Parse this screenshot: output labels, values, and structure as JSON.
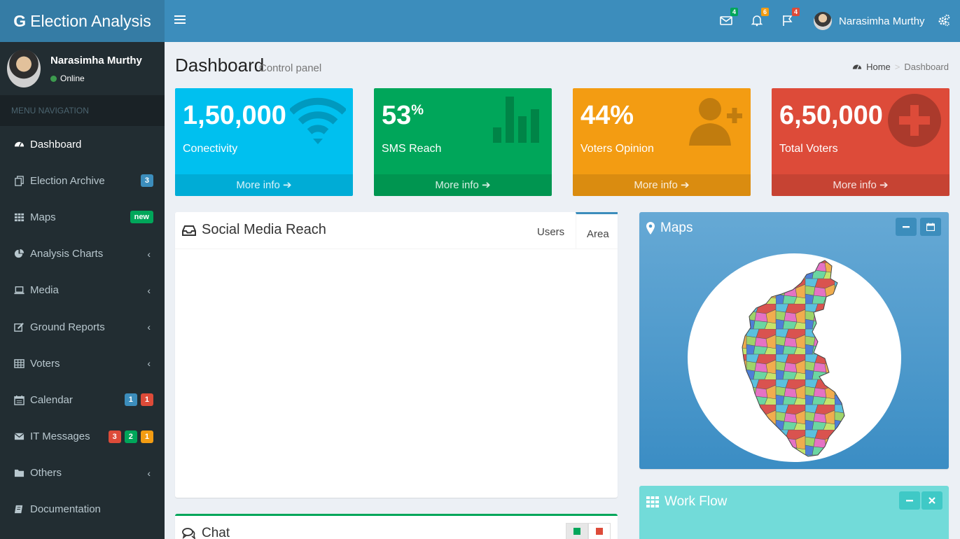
{
  "brand": {
    "logo_letter": "G",
    "name": "Election Analysis"
  },
  "topbar": {
    "notifications": [
      {
        "name": "mail",
        "count": "4",
        "color": "#00a65a"
      },
      {
        "name": "bell",
        "count": "6",
        "color": "#f39c12"
      },
      {
        "name": "flag",
        "count": "4",
        "color": "#dd4b39"
      }
    ],
    "user_name": "Narasimha Murthy"
  },
  "sidebar": {
    "user_name": "Narasimha Murthy",
    "status": "Online",
    "menu_header": "MENU NAVIGATION",
    "items": [
      {
        "label": "Dashboard",
        "icon": "dashboard-icon"
      },
      {
        "label": "Election Archive",
        "icon": "archive-icon",
        "badges": [
          {
            "text": "3",
            "color": "#3c8dbc"
          }
        ]
      },
      {
        "label": "Maps",
        "icon": "grid-icon",
        "badges": [
          {
            "text": "new",
            "color": "#00a65a"
          }
        ]
      },
      {
        "label": "Analysis Charts",
        "icon": "pie-chart-icon",
        "chevron": "‹"
      },
      {
        "label": "Media",
        "icon": "laptop-icon",
        "chevron": "‹"
      },
      {
        "label": "Ground Reports",
        "icon": "edit-icon",
        "chevron": "‹"
      },
      {
        "label": "Voters",
        "icon": "table-icon",
        "chevron": "‹"
      },
      {
        "label": "Calendar",
        "icon": "calendar-icon",
        "badges": [
          {
            "text": "1",
            "color": "#3c8dbc"
          },
          {
            "text": "1",
            "color": "#dd4b39"
          }
        ]
      },
      {
        "label": "IT Messages",
        "icon": "envelope-icon",
        "badges": [
          {
            "text": "3",
            "color": "#dd4b39"
          },
          {
            "text": "2",
            "color": "#00a65a"
          },
          {
            "text": "1",
            "color": "#f39c12"
          }
        ]
      },
      {
        "label": "Others",
        "icon": "folder-icon",
        "chevron": "‹"
      },
      {
        "label": "Documentation",
        "icon": "book-icon"
      }
    ]
  },
  "header": {
    "title": "Dashboard",
    "subtitle": "Control panel",
    "breadcrumb_home": "Home",
    "breadcrumb_sep": ">",
    "breadcrumb_current": "Dashboard"
  },
  "stats": [
    {
      "value": "1,50,000",
      "suffix": "",
      "label": "Conectivity",
      "more": "More info",
      "color": "#00c0ef",
      "icon": "wifi-icon"
    },
    {
      "value": "53",
      "suffix": "%",
      "label": "SMS Reach",
      "more": "More info",
      "color": "#00a65a",
      "icon": "bar-chart-icon"
    },
    {
      "value": "44%",
      "suffix": "",
      "label": "Voters Opinion",
      "more": "More info",
      "color": "#f39c12",
      "icon": "user-plus-icon"
    },
    {
      "value": "6,50,000",
      "suffix": "",
      "label": "Total Voters",
      "more": "More info",
      "color": "#dd4b39",
      "icon": "plus-circle-icon"
    }
  ],
  "social": {
    "title": "Social Media Reach",
    "tabs": [
      "Users",
      "Area"
    ],
    "active_tab": "Area"
  },
  "maps": {
    "title": "Maps"
  },
  "workflow": {
    "title": "Work Flow"
  },
  "chat": {
    "title": "Chat"
  }
}
